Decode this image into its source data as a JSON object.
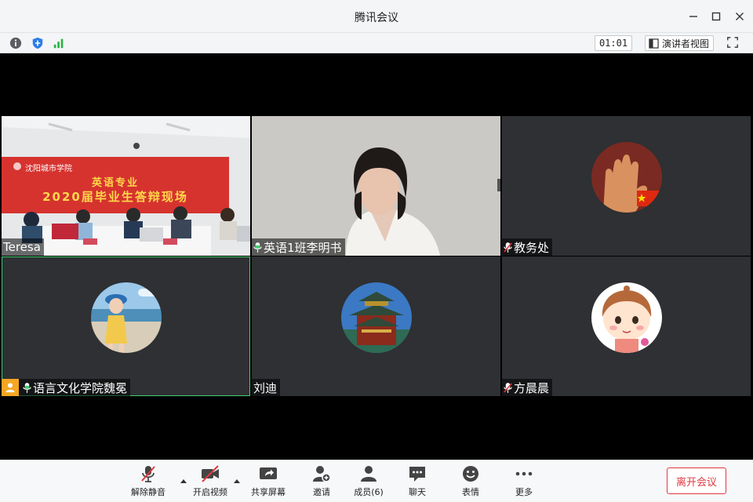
{
  "window": {
    "title": "腾讯会议"
  },
  "status": {
    "timer": "01:01",
    "speaker_view_label": "演讲者视图"
  },
  "participants": [
    {
      "name": "Teresa",
      "mic": "none"
    },
    {
      "name": "英语1班李明书",
      "mic": "on"
    },
    {
      "name": "教务处",
      "mic": "muted"
    },
    {
      "name": "语言文化学院魏冕",
      "mic": "on"
    },
    {
      "name": "刘迪",
      "mic": "none"
    },
    {
      "name": "方晨晨",
      "mic": "muted"
    }
  ],
  "banner": {
    "school": "沈阳城市学院",
    "line1": "英语专业",
    "line2": "2020届毕业生答辩现场"
  },
  "toolbar": {
    "unmute_label": "解除静音",
    "video_label": "开启视频",
    "share_label": "共享屏幕",
    "invite_label": "邀请",
    "members_label": "成员(6)",
    "chat_label": "聊天",
    "emoji_label": "表情",
    "more_label": "更多",
    "leave_label": "离开会议"
  },
  "colors": {
    "accent_green": "#3fcf6e",
    "leave_red": "#e0393e",
    "tile_bg": "#2e3033"
  }
}
